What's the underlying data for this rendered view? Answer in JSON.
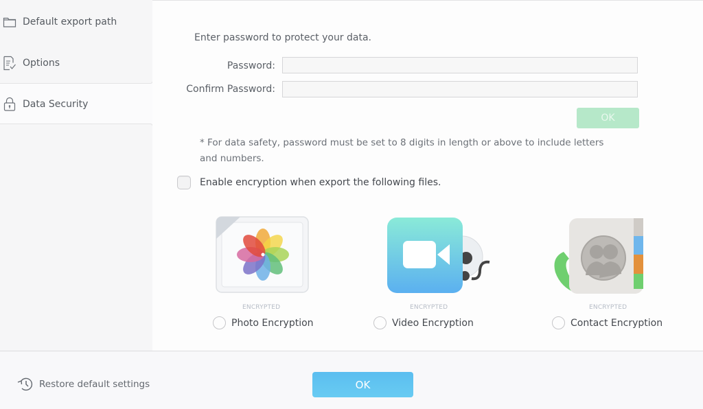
{
  "sidebar": {
    "items": [
      {
        "label": "Default export path",
        "icon": "folder-icon"
      },
      {
        "label": "Options",
        "icon": "checklist-document-icon"
      },
      {
        "label": "Data Security",
        "icon": "lock-icon",
        "selected": true
      }
    ]
  },
  "main": {
    "intro": "Enter password to protect your data.",
    "password_label": "Password:",
    "password_value": "",
    "confirm_label": "Confirm Password:",
    "confirm_value": "",
    "ok_small_label": "OK",
    "note": "* For data safety, password must be set to 8 digits in length or above to include letters and numbers.",
    "enable_label": "Enable encryption when export the following files.",
    "enable_checked": false,
    "encryption_options": [
      {
        "tag": "ENCRYPTED",
        "label": "Photo Encryption",
        "icon": "photos-icon",
        "selected": false
      },
      {
        "tag": "ENCRYPTED",
        "label": "Video Encryption",
        "icon": "video-camera-icon",
        "selected": false
      },
      {
        "tag": "ENCRYPTED",
        "label": "Contact Encryption",
        "icon": "contacts-icon",
        "selected": false
      }
    ]
  },
  "footer": {
    "restore_label": "Restore default settings",
    "ok_label": "OK"
  },
  "colors": {
    "primary_button": "#5bbef0",
    "disabled_ok": "#b6e8c9"
  }
}
